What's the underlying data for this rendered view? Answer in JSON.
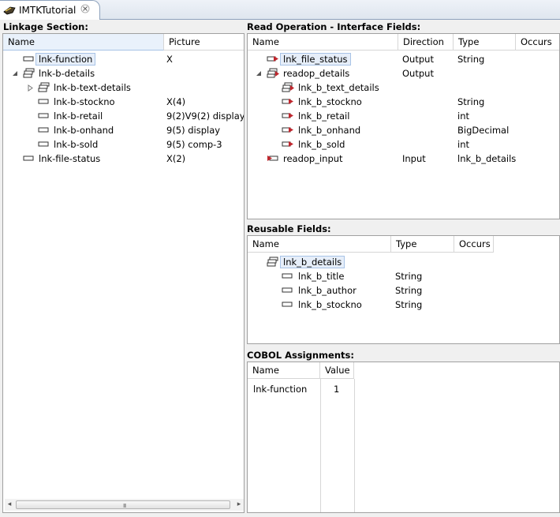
{
  "tab": {
    "title": "IMTKTutorial",
    "icon": "program-icon",
    "close_icon": "close-icon"
  },
  "linkage": {
    "title": "Linkage Section:",
    "columns": {
      "name": "Name",
      "picture": "Picture"
    },
    "rows": [
      {
        "name": "lnk-function",
        "picture": "X"
      },
      {
        "name": "lnk-b-details",
        "picture": ""
      },
      {
        "name": "lnk-b-text-details",
        "picture": ""
      },
      {
        "name": "lnk-b-stockno",
        "picture": "X(4)"
      },
      {
        "name": "lnk-b-retail",
        "picture": "9(2)V9(2) display"
      },
      {
        "name": "lnk-b-onhand",
        "picture": "9(5) display"
      },
      {
        "name": "lnk-b-sold",
        "picture": "9(5) comp-3"
      },
      {
        "name": "lnk-file-status",
        "picture": "X(2)"
      }
    ],
    "scroll_grip": "III"
  },
  "read_op": {
    "title": "Read Operation - Interface Fields:",
    "columns": {
      "name": "Name",
      "direction": "Direction",
      "type": "Type",
      "occurs": "Occurs"
    },
    "rows": [
      {
        "name": "lnk_file_status",
        "direction": "Output",
        "type": "String"
      },
      {
        "name": "readop_details",
        "direction": "Output",
        "type": ""
      },
      {
        "name": "lnk_b_text_details",
        "direction": "",
        "type": ""
      },
      {
        "name": "lnk_b_stockno",
        "direction": "",
        "type": "String"
      },
      {
        "name": "lnk_b_retail",
        "direction": "",
        "type": "int"
      },
      {
        "name": "lnk_b_onhand",
        "direction": "",
        "type": "BigDecimal"
      },
      {
        "name": "lnk_b_sold",
        "direction": "",
        "type": "int"
      },
      {
        "name": "readop_input",
        "direction": "Input",
        "type": "lnk_b_details"
      }
    ]
  },
  "reusable": {
    "title": "Reusable Fields:",
    "columns": {
      "name": "Name",
      "type": "Type",
      "occurs": "Occurs"
    },
    "rows": [
      {
        "name": "lnk_b_details",
        "type": ""
      },
      {
        "name": "lnk_b_title",
        "type": "String"
      },
      {
        "name": "lnk_b_author",
        "type": "String"
      },
      {
        "name": "lnk_b_stockno",
        "type": "String"
      }
    ]
  },
  "cobol": {
    "title": "COBOL Assignments:",
    "columns": {
      "name": "Name",
      "value": "Value"
    },
    "rows": [
      {
        "name": "lnk-function",
        "value": "1"
      }
    ]
  }
}
